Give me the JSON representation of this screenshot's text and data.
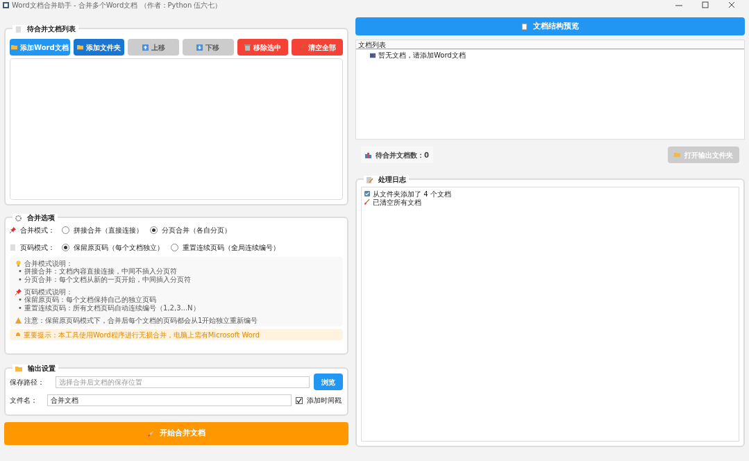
{
  "window": {
    "title": "Word文档合并助手 - 合并多个Word文档 （作者：Python 伍六七）"
  },
  "file_list": {
    "title": "待合并文档列表",
    "buttons": [
      {
        "label": "添加Word文档",
        "disabled": false
      },
      {
        "label": "添加文件夹",
        "disabled": false
      },
      {
        "label": "上移",
        "disabled": true
      },
      {
        "label": "下移",
        "disabled": true
      },
      {
        "label": "移除选中",
        "disabled": false
      },
      {
        "label": "清空全部",
        "disabled": false
      }
    ]
  },
  "merge_options": {
    "title": "合并选项",
    "groups": [
      {
        "label": "合并模式：",
        "options": [
          {
            "label": "拼接合并（直接连接）",
            "selected": false
          },
          {
            "label": "分页合并（各自分页）",
            "selected": true
          }
        ]
      },
      {
        "label": "页码模式：",
        "options": [
          {
            "label": "保留原页码（每个文档独立）",
            "selected": true
          },
          {
            "label": "重置连续页码（全局连续编号）",
            "selected": false
          }
        ]
      }
    ],
    "help": [
      {
        "kind": "heading",
        "text": "合并模式说明："
      },
      {
        "kind": "bullet",
        "text": "• 拼接合并：文档内容直接连接，中间不插入分页符"
      },
      {
        "kind": "bullet",
        "text": "• 分页合并：每个文档从新的一页开始，中间插入分页符"
      },
      {
        "kind": "gap"
      },
      {
        "kind": "heading",
        "text": "页码模式说明："
      },
      {
        "kind": "bullet",
        "text": "• 保留原页码：每个文档保持自己的独立页码"
      },
      {
        "kind": "bullet",
        "text": "• 重置连续页码：所有文档页码自动连续编号（1,2,3...N）"
      },
      {
        "kind": "gap"
      },
      {
        "kind": "heading",
        "text": "注意：保留原页码模式下，合并后每个文档的页码都会从1开始独立重新编号"
      }
    ],
    "tip": "重要提示：本工具使用Word程序进行无损合并，电脑上需有Microsoft Word"
  },
  "output": {
    "title": "输出设置",
    "path_label": "保存路径：",
    "path_placeholder": "选择合并后文档的保存位置",
    "browse": "浏览",
    "name_label": "文件名：",
    "name_value": "合并文档",
    "timestamp": {
      "label": "添加时间戳",
      "checked": true
    }
  },
  "start_button": "开始合并文档",
  "preview": {
    "button": "文档结构预览",
    "header": "文档列表",
    "items": [
      "暂无文档，请添加Word文档"
    ]
  },
  "count": "待合并文档数：0",
  "open_folder": {
    "label": "打开输出文件夹",
    "disabled": true
  },
  "log": {
    "title": "处理日志",
    "lines": [
      "从文件夹添加了 4 个文档",
      "已清空所有文档"
    ]
  }
}
